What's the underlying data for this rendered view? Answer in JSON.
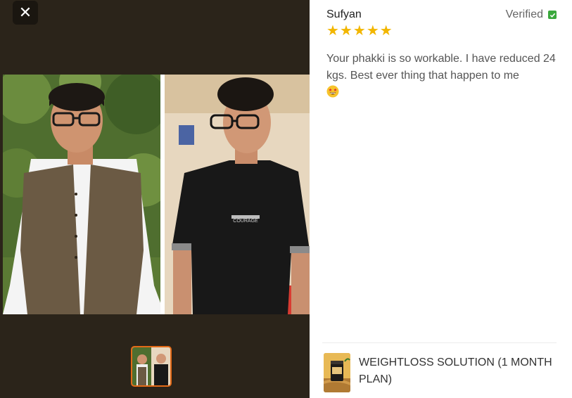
{
  "modal": {
    "close_label": "✕"
  },
  "review": {
    "reviewer": "Sufyan",
    "verified_label": "Verified",
    "rating": 5,
    "text": "Your phakki is so workable. I have reduced 24 kgs. Best ever thing that happen to me",
    "emoji": "star-struck"
  },
  "product": {
    "name": "WEIGHTLOSS SOLUTION (1 MONTH PLAN)"
  },
  "photo": {
    "shirt_text": "COURAGE"
  },
  "colors": {
    "accent": "#e36a17",
    "star": "#f2b600",
    "verified": "#3aa83c",
    "media_bg": "#2b241a"
  }
}
